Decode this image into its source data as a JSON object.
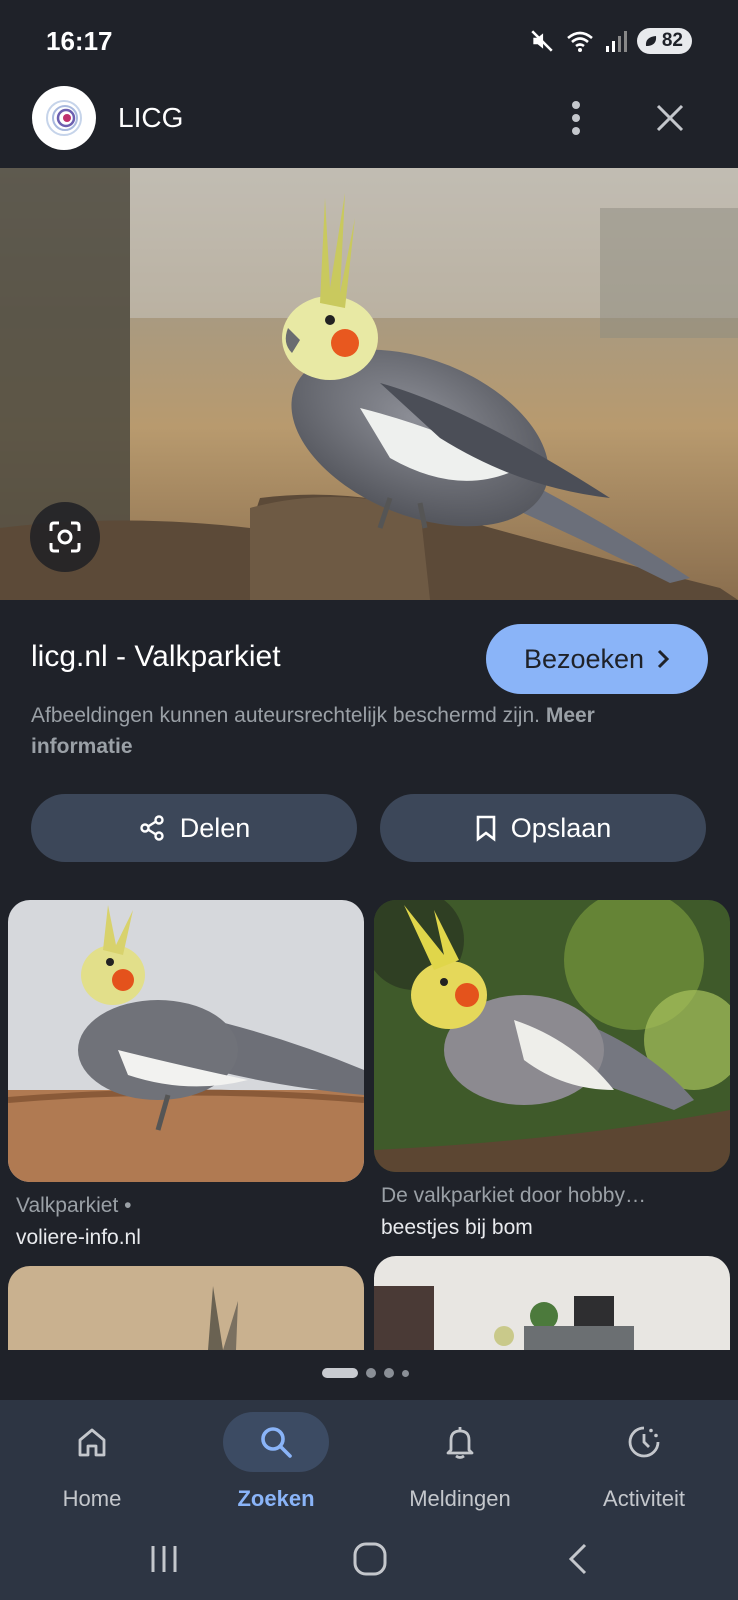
{
  "status": {
    "time": "16:17",
    "battery": "82",
    "icons": [
      "mute-icon",
      "wifi-icon",
      "signal-icon",
      "battery-icon"
    ]
  },
  "header": {
    "title": "LICG",
    "menu_icon": "more-vert-icon",
    "close_icon": "close-icon"
  },
  "result": {
    "title": "licg.nl - Valkparkiet",
    "visit_label": "Bezoeken",
    "copyright_text": "Afbeeldingen kunnen auteursrechtelijk beschermd zijn.",
    "copyright_link": "Meer informatie",
    "share_label": "Delen",
    "save_label": "Opslaan"
  },
  "related": [
    {
      "title": "Valkparkiet •",
      "source": "voliere-info.nl"
    },
    {
      "title": "De valkparkiet door hobby…",
      "source": "beestjes bij bom"
    }
  ],
  "nav": {
    "items": [
      {
        "label": "Home",
        "icon": "home-icon"
      },
      {
        "label": "Zoeken",
        "icon": "search-icon"
      },
      {
        "label": "Meldingen",
        "icon": "bell-icon"
      },
      {
        "label": "Activiteit",
        "icon": "activity-icon"
      }
    ],
    "active": "Zoeken"
  },
  "colors": {
    "accent": "#8ab4f8",
    "background": "#1f2229",
    "button": "#3c4759",
    "nav": "#2d3543"
  }
}
